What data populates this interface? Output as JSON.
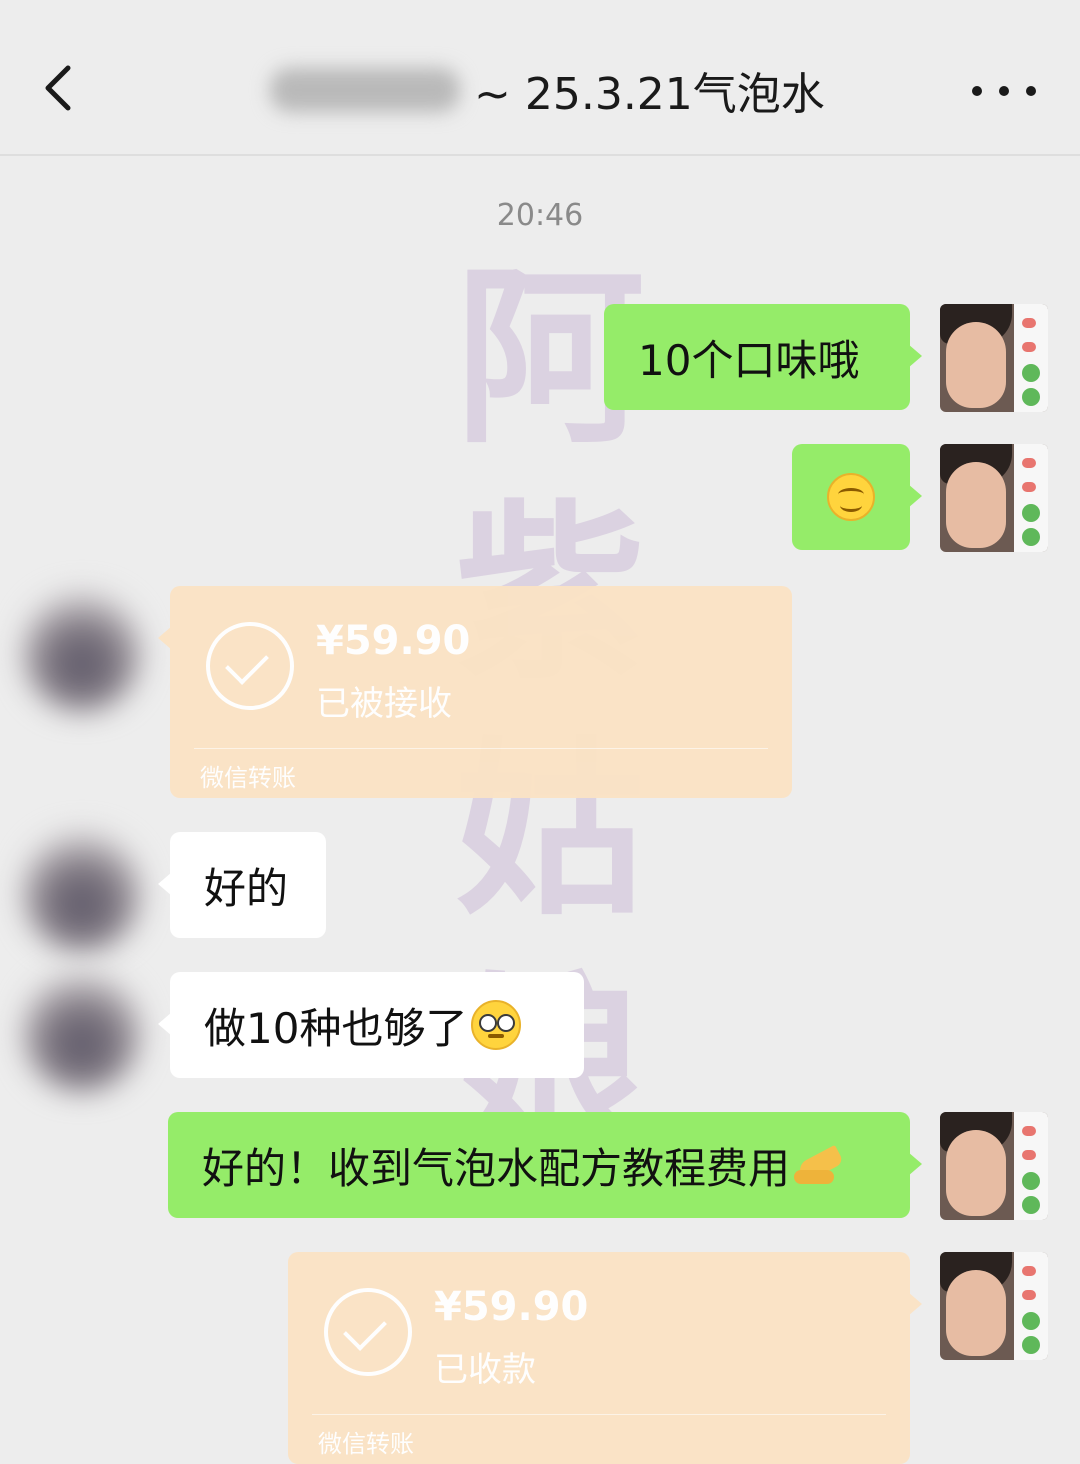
{
  "header": {
    "title": "~ 25.3.21气泡水"
  },
  "timestamp": "20:46",
  "watermark": [
    "阿",
    "紫",
    "姑",
    "娘"
  ],
  "messages": {
    "m1": "10个口味哦",
    "m3": {
      "amount": "¥59.90",
      "status": "已被接收",
      "footer": "微信转账"
    },
    "m4": "好的",
    "m5": "做10种也够了",
    "m6": "好的！收到气泡水配方教程费用",
    "m7": {
      "amount": "¥59.90",
      "status": "已收款",
      "footer": "微信转账"
    }
  },
  "icons": {
    "back": "back-chevron-icon",
    "more": "more-dots-icon",
    "smile": "smile-emoji-icon",
    "glasses": "glasses-emoji-icon",
    "pray": "praying-hands-emoji-icon",
    "check": "check-circle-icon"
  },
  "colors": {
    "background": "#ededed",
    "self_bubble": "#95ec69",
    "other_bubble": "#ffffff",
    "transfer_card": "#fbe3c4"
  }
}
